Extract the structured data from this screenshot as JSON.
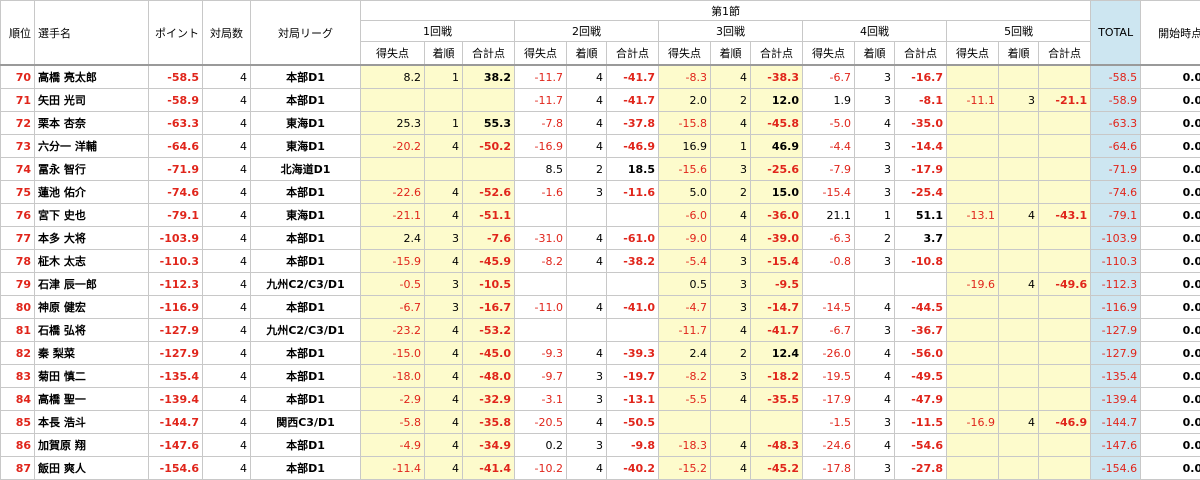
{
  "headers": {
    "rank": "順位",
    "player": "選手名",
    "points": "ポイント",
    "games": "対局数",
    "league": "対局リーグ",
    "section": "第1節",
    "rounds": [
      "1回戦",
      "2回戦",
      "3回戦",
      "4回戦",
      "5回戦"
    ],
    "sub": [
      "得失点",
      "着順",
      "合計点"
    ],
    "total": "TOTAL",
    "start": "開始時点"
  },
  "rows": [
    {
      "rank": "70",
      "name": "高橋 亮太郎",
      "points": "-58.5",
      "games": "4",
      "league": "本部D1",
      "rounds": [
        [
          "8.2",
          "1",
          "38.2"
        ],
        [
          "-11.7",
          "4",
          "-41.7"
        ],
        [
          "-8.3",
          "4",
          "-38.3"
        ],
        [
          "-6.7",
          "3",
          "-16.7"
        ],
        [
          "",
          "",
          ""
        ]
      ],
      "total": "-58.5",
      "start": "0.0"
    },
    {
      "rank": "71",
      "name": "矢田 光司",
      "points": "-58.9",
      "games": "4",
      "league": "本部D1",
      "rounds": [
        [
          "",
          "",
          ""
        ],
        [
          "-11.7",
          "4",
          "-41.7"
        ],
        [
          "2.0",
          "2",
          "12.0"
        ],
        [
          "1.9",
          "3",
          "-8.1"
        ],
        [
          "-11.1",
          "3",
          "-21.1"
        ]
      ],
      "total": "-58.9",
      "start": "0.0"
    },
    {
      "rank": "72",
      "name": "栗本 杏奈",
      "points": "-63.3",
      "games": "4",
      "league": "東海D1",
      "rounds": [
        [
          "25.3",
          "1",
          "55.3"
        ],
        [
          "-7.8",
          "4",
          "-37.8"
        ],
        [
          "-15.8",
          "4",
          "-45.8"
        ],
        [
          "-5.0",
          "4",
          "-35.0"
        ],
        [
          "",
          "",
          ""
        ]
      ],
      "total": "-63.3",
      "start": "0.0"
    },
    {
      "rank": "73",
      "name": "六分一 洋輔",
      "points": "-64.6",
      "games": "4",
      "league": "東海D1",
      "rounds": [
        [
          "-20.2",
          "4",
          "-50.2"
        ],
        [
          "-16.9",
          "4",
          "-46.9"
        ],
        [
          "16.9",
          "1",
          "46.9"
        ],
        [
          "-4.4",
          "3",
          "-14.4"
        ],
        [
          "",
          "",
          ""
        ]
      ],
      "total": "-64.6",
      "start": "0.0"
    },
    {
      "rank": "74",
      "name": "冨永 智行",
      "points": "-71.9",
      "games": "4",
      "league": "北海道D1",
      "rounds": [
        [
          "",
          "",
          ""
        ],
        [
          "8.5",
          "2",
          "18.5"
        ],
        [
          "-15.6",
          "3",
          "-25.6"
        ],
        [
          "-7.9",
          "3",
          "-17.9"
        ],
        [
          "",
          "",
          ""
        ]
      ],
      "total": "-71.9",
      "start": "0.0"
    },
    {
      "rank": "75",
      "name": "蓮池 佑介",
      "points": "-74.6",
      "games": "4",
      "league": "本部D1",
      "rounds": [
        [
          "-22.6",
          "4",
          "-52.6"
        ],
        [
          "-1.6",
          "3",
          "-11.6"
        ],
        [
          "5.0",
          "2",
          "15.0"
        ],
        [
          "-15.4",
          "3",
          "-25.4"
        ],
        [
          "",
          "",
          ""
        ]
      ],
      "total": "-74.6",
      "start": "0.0"
    },
    {
      "rank": "76",
      "name": "宮下 史也",
      "points": "-79.1",
      "games": "4",
      "league": "東海D1",
      "rounds": [
        [
          "-21.1",
          "4",
          "-51.1"
        ],
        [
          "",
          "",
          ""
        ],
        [
          "-6.0",
          "4",
          "-36.0"
        ],
        [
          "21.1",
          "1",
          "51.1"
        ],
        [
          "-13.1",
          "4",
          "-43.1"
        ]
      ],
      "total": "-79.1",
      "start": "0.0"
    },
    {
      "rank": "77",
      "name": "本多 大将",
      "points": "-103.9",
      "games": "4",
      "league": "本部D1",
      "rounds": [
        [
          "2.4",
          "3",
          "-7.6"
        ],
        [
          "-31.0",
          "4",
          "-61.0"
        ],
        [
          "-9.0",
          "4",
          "-39.0"
        ],
        [
          "-6.3",
          "2",
          "3.7"
        ],
        [
          "",
          "",
          ""
        ]
      ],
      "total": "-103.9",
      "start": "0.0"
    },
    {
      "rank": "78",
      "name": "柾木 太志",
      "points": "-110.3",
      "games": "4",
      "league": "本部D1",
      "rounds": [
        [
          "-15.9",
          "4",
          "-45.9"
        ],
        [
          "-8.2",
          "4",
          "-38.2"
        ],
        [
          "-5.4",
          "3",
          "-15.4"
        ],
        [
          "-0.8",
          "3",
          "-10.8"
        ],
        [
          "",
          "",
          ""
        ]
      ],
      "total": "-110.3",
      "start": "0.0"
    },
    {
      "rank": "79",
      "name": "石津 辰一郎",
      "points": "-112.3",
      "games": "4",
      "league": "九州C2/C3/D1",
      "rounds": [
        [
          "-0.5",
          "3",
          "-10.5"
        ],
        [
          "",
          "",
          ""
        ],
        [
          "0.5",
          "3",
          "-9.5"
        ],
        [
          "",
          "",
          ""
        ],
        [
          "-19.6",
          "4",
          "-49.6"
        ]
      ],
      "total": "-112.3",
      "start": "0.0"
    },
    {
      "rank": "80",
      "name": "神原 健宏",
      "points": "-116.9",
      "games": "4",
      "league": "本部D1",
      "rounds": [
        [
          "-6.7",
          "3",
          "-16.7"
        ],
        [
          "-11.0",
          "4",
          "-41.0"
        ],
        [
          "-4.7",
          "3",
          "-14.7"
        ],
        [
          "-14.5",
          "4",
          "-44.5"
        ],
        [
          "",
          "",
          ""
        ]
      ],
      "total": "-116.9",
      "start": "0.0"
    },
    {
      "rank": "81",
      "name": "石橋 弘将",
      "points": "-127.9",
      "games": "4",
      "league": "九州C2/C3/D1",
      "rounds": [
        [
          "-23.2",
          "4",
          "-53.2"
        ],
        [
          "",
          "",
          ""
        ],
        [
          "-11.7",
          "4",
          "-41.7"
        ],
        [
          "-6.7",
          "3",
          "-36.7"
        ],
        [
          "",
          "",
          ""
        ]
      ],
      "total": "-127.9",
      "start": "0.0"
    },
    {
      "rank": "82",
      "name": "秦 梨菜",
      "points": "-127.9",
      "games": "4",
      "league": "本部D1",
      "rounds": [
        [
          "-15.0",
          "4",
          "-45.0"
        ],
        [
          "-9.3",
          "4",
          "-39.3"
        ],
        [
          "2.4",
          "2",
          "12.4"
        ],
        [
          "-26.0",
          "4",
          "-56.0"
        ],
        [
          "",
          "",
          ""
        ]
      ],
      "total": "-127.9",
      "start": "0.0"
    },
    {
      "rank": "83",
      "name": "菊田 慎二",
      "points": "-135.4",
      "games": "4",
      "league": "本部D1",
      "rounds": [
        [
          "-18.0",
          "4",
          "-48.0"
        ],
        [
          "-9.7",
          "3",
          "-19.7"
        ],
        [
          "-8.2",
          "3",
          "-18.2"
        ],
        [
          "-19.5",
          "4",
          "-49.5"
        ],
        [
          "",
          "",
          ""
        ]
      ],
      "total": "-135.4",
      "start": "0.0"
    },
    {
      "rank": "84",
      "name": "高橋 聖一",
      "points": "-139.4",
      "games": "4",
      "league": "本部D1",
      "rounds": [
        [
          "-2.9",
          "4",
          "-32.9"
        ],
        [
          "-3.1",
          "3",
          "-13.1"
        ],
        [
          "-5.5",
          "4",
          "-35.5"
        ],
        [
          "-17.9",
          "4",
          "-47.9"
        ],
        [
          "",
          "",
          ""
        ]
      ],
      "total": "-139.4",
      "start": "0.0"
    },
    {
      "rank": "85",
      "name": "本長 浩斗",
      "points": "-144.7",
      "games": "4",
      "league": "関西C3/D1",
      "rounds": [
        [
          "-5.8",
          "4",
          "-35.8"
        ],
        [
          "-20.5",
          "4",
          "-50.5"
        ],
        [
          "",
          "",
          ""
        ],
        [
          "-1.5",
          "3",
          "-11.5"
        ],
        [
          "-16.9",
          "4",
          "-46.9"
        ]
      ],
      "total": "-144.7",
      "start": "0.0"
    },
    {
      "rank": "86",
      "name": "加賀原 翔",
      "points": "-147.6",
      "games": "4",
      "league": "本部D1",
      "rounds": [
        [
          "-4.9",
          "4",
          "-34.9"
        ],
        [
          "0.2",
          "3",
          "-9.8"
        ],
        [
          "-18.3",
          "4",
          "-48.3"
        ],
        [
          "-24.6",
          "4",
          "-54.6"
        ],
        [
          "",
          "",
          ""
        ]
      ],
      "total": "-147.6",
      "start": "0.0"
    },
    {
      "rank": "87",
      "name": "飯田 爽人",
      "points": "-154.6",
      "games": "4",
      "league": "本部D1",
      "rounds": [
        [
          "-11.4",
          "4",
          "-41.4"
        ],
        [
          "-10.2",
          "4",
          "-40.2"
        ],
        [
          "-15.2",
          "4",
          "-45.2"
        ],
        [
          "-17.8",
          "3",
          "-27.8"
        ],
        [
          "",
          "",
          ""
        ]
      ],
      "total": "-154.6",
      "start": "0.0"
    }
  ]
}
